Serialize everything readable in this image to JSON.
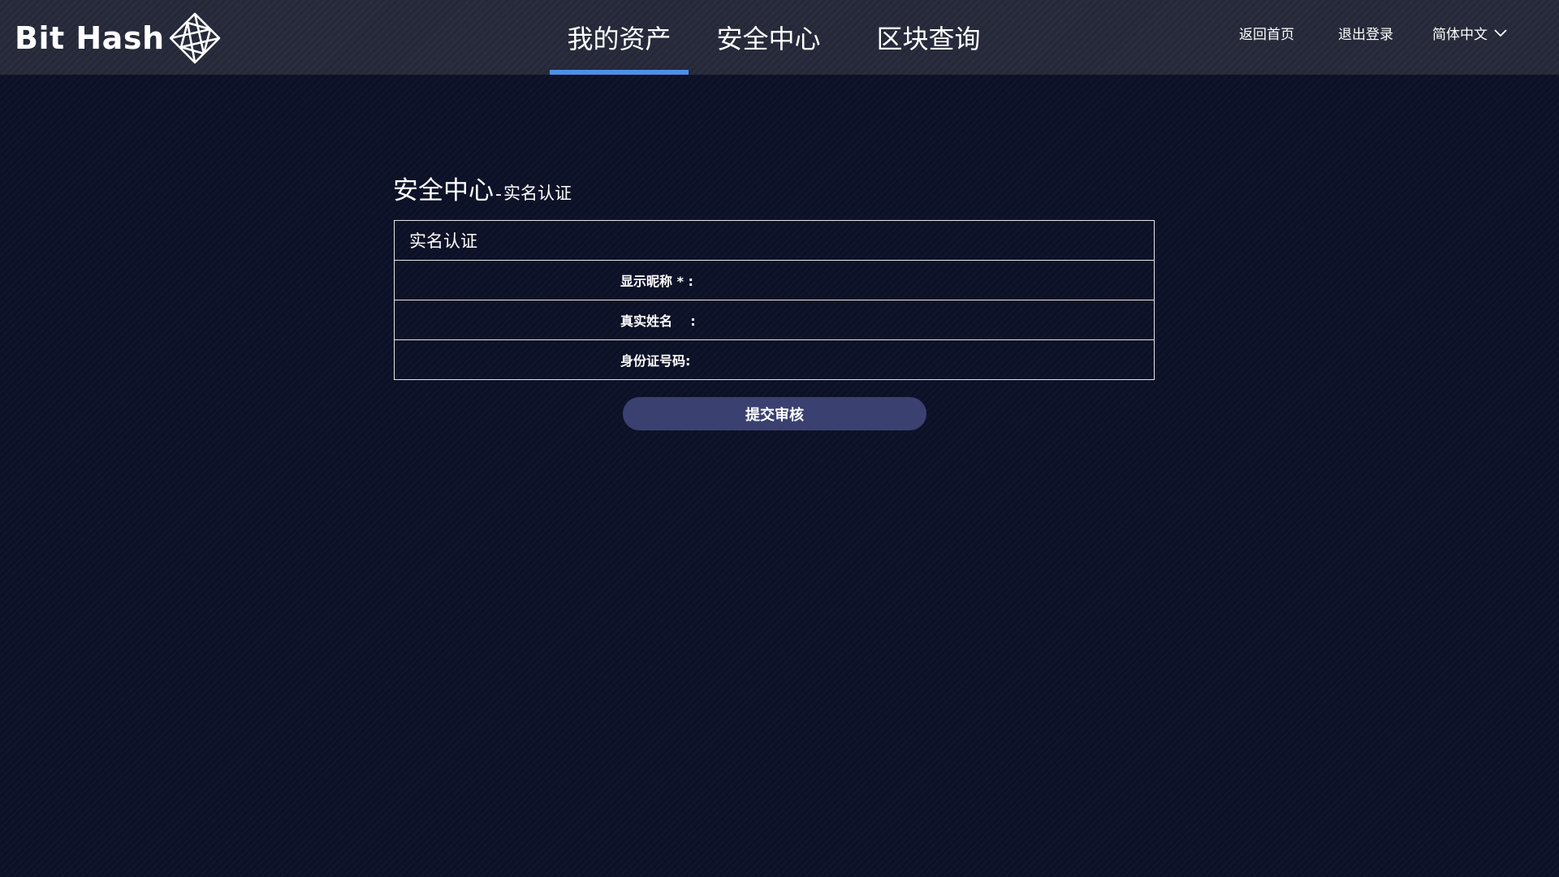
{
  "brand": {
    "name": "Bit Hash",
    "logo_icon": "diamond-geometric-logo-icon"
  },
  "nav": {
    "tabs": [
      {
        "label": "我的资产",
        "active": true
      },
      {
        "label": "安全中心",
        "active": false
      },
      {
        "label": "区块查询",
        "active": false
      }
    ]
  },
  "header_links": {
    "home": "返回首页",
    "logout": "退出登录",
    "language": "简体中文",
    "language_icon": "chevron-down-icon"
  },
  "page": {
    "title": "安全中心",
    "separator": "-",
    "subtitle": "实名认证"
  },
  "form": {
    "header": "实名认证",
    "fields": [
      {
        "label": "显示昵称 * :",
        "value": "",
        "placeholder": ""
      },
      {
        "label": "真实姓名    :",
        "value": "",
        "placeholder": ""
      },
      {
        "label": "身份证号码:",
        "value": "",
        "placeholder": ""
      }
    ],
    "submit_label": "提交审核"
  },
  "colors": {
    "background": "#0d1127",
    "topbar": "#242838",
    "active_tab_underline": "#4e8fe8",
    "submit_button": "#3a4170",
    "form_border": "#e6e6e6"
  }
}
